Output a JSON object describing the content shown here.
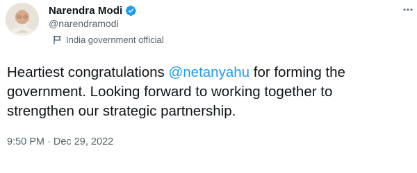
{
  "tweet": {
    "author": {
      "display_name": "Narendra Modi",
      "handle": "@narendramodi",
      "verified": true,
      "verified_color": "#1d9bf0",
      "label": "India government official",
      "label_icon": "flag-icon"
    },
    "text": {
      "line1_before": "Heartiest congratulations ",
      "mention": "@netanyahu",
      "line1_after": " for forming the",
      "line2": "government. Looking forward to working together to",
      "line3": "strengthen our strategic partnership."
    },
    "time": "9:50 PM",
    "separator": " · ",
    "date": "Dec 29, 2022",
    "colors": {
      "text": "#0f1419",
      "secondary": "#536471",
      "link": "#1d9bf0"
    }
  }
}
